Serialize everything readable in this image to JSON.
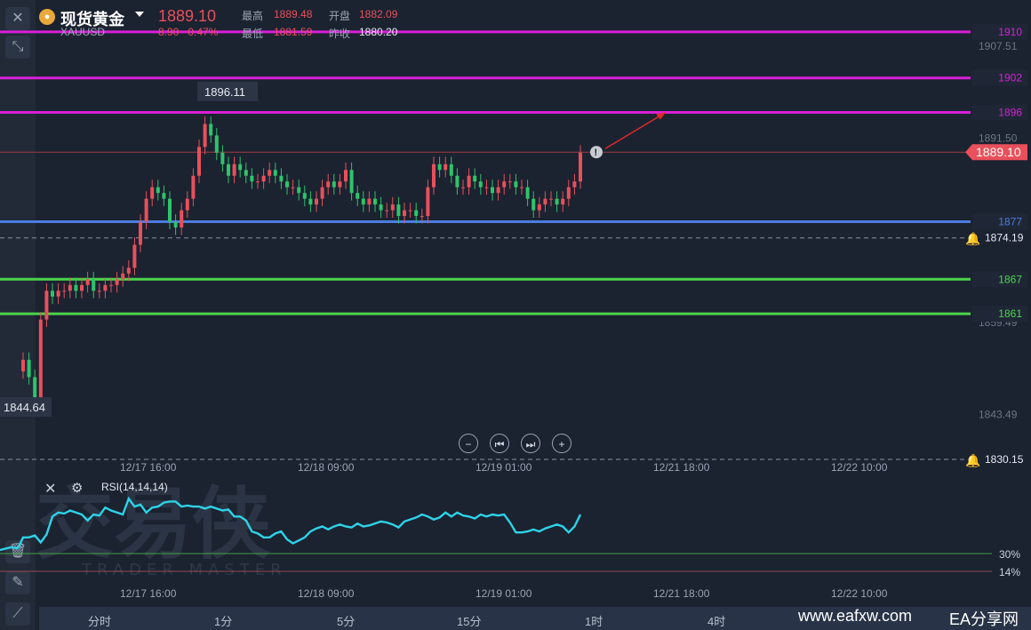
{
  "header": {
    "name": "现货黄金",
    "symbol": "XAUUSD",
    "price": "1889.10",
    "change": "8.90",
    "change_pct": "0.47%",
    "high_label": "最高",
    "high": "1889.48",
    "low_label": "最低",
    "low": "1881.59",
    "open_label": "开盘",
    "open": "1882.09",
    "prev_close_label": "昨收",
    "prev_close": "1880.20"
  },
  "left_toolbar": {
    "icons": [
      "close-icon",
      "collapse-icon",
      "trash-icon",
      "pencil-icon",
      "line-chart-icon"
    ]
  },
  "controls": {
    "icons": [
      "zoom-out-icon",
      "step-back-icon",
      "step-forward-icon",
      "zoom-in-icon"
    ]
  },
  "chart_data": [
    {
      "type": "candlestick",
      "title": "XAUUSD",
      "ylim": [
        1836,
        1914
      ],
      "y_ticks": [
        "1907.51",
        "1891.50",
        "1874.19",
        "1859.49",
        "1843.49"
      ],
      "x_ticks": [
        "12/17 16:00",
        "12/18 09:00",
        "12/19 01:00",
        "12/21 18:00",
        "12/22 10:00"
      ],
      "current_price": "1889.10",
      "high_label": "1896.11",
      "low_label": "1844.64",
      "levels": [
        {
          "label": "1910",
          "value": 1910,
          "color": "#d81fd8"
        },
        {
          "label": "1902",
          "value": 1902,
          "color": "#d81fd8"
        },
        {
          "label": "1896",
          "value": 1896,
          "color": "#d81fd8"
        },
        {
          "label": "1877",
          "value": 1877,
          "color": "#4a7de0"
        },
        {
          "label": "1867",
          "value": 1867,
          "color": "#4cd34c"
        },
        {
          "label": "1861",
          "value": 1861,
          "color": "#4cd34c"
        }
      ],
      "alerts": [
        {
          "label": "1874.19",
          "value": 1874.19
        },
        {
          "label": "1830.15",
          "value": 1830.15
        }
      ],
      "closes": [
        1853,
        1850,
        1846,
        1860,
        1865,
        1864,
        1865,
        1865,
        1866,
        1865,
        1866,
        1867,
        1865,
        1865,
        1866,
        1866,
        1867,
        1868,
        1869,
        1873,
        1877,
        1881,
        1883,
        1882,
        1881,
        1877,
        1876,
        1879,
        1881,
        1885,
        1890,
        1894,
        1892,
        1889,
        1887,
        1885,
        1887,
        1886,
        1885,
        1884,
        1884,
        1885,
        1886,
        1885,
        1884,
        1883,
        1883,
        1882,
        1881,
        1880,
        1881,
        1883,
        1884,
        1883,
        1884,
        1886,
        1882,
        1881,
        1880,
        1881,
        1880,
        1879,
        1879,
        1880,
        1878,
        1879,
        1879,
        1878,
        1878,
        1883,
        1887,
        1886,
        1887,
        1885,
        1883,
        1883,
        1885,
        1884,
        1883,
        1883,
        1882,
        1883,
        1884,
        1884,
        1883,
        1883,
        1881,
        1879,
        1880,
        1881,
        1881,
        1880,
        1881,
        1883,
        1884,
        1889
      ],
      "colors": {
        "up": "#e8505b",
        "down": "#2ec46b"
      }
    },
    {
      "type": "line",
      "title": "RSI(14,14,14)",
      "ylim": [
        0,
        100
      ],
      "levels": [
        {
          "label": "30%",
          "value": 30
        },
        {
          "label": "14%",
          "value": 14
        }
      ],
      "x_ticks": [
        "12/17 16:00",
        "12/18 09:00",
        "12/19 01:00",
        "12/21 18:00",
        "12/22 10:00"
      ],
      "values": [
        35,
        35,
        37,
        30,
        38,
        56,
        60,
        59,
        62,
        60,
        58,
        52,
        58,
        57,
        65,
        62,
        60,
        58,
        74,
        66,
        68,
        60,
        65,
        66,
        70,
        71,
        71,
        66,
        67,
        66,
        66,
        64,
        66,
        64,
        62,
        63,
        56,
        56,
        52,
        41,
        39,
        35,
        35,
        39,
        41,
        33,
        29,
        32,
        35,
        41,
        44,
        46,
        43,
        46,
        48,
        46,
        45,
        49,
        46,
        47,
        49,
        51,
        50,
        48,
        45,
        51,
        53,
        55,
        58,
        56,
        53,
        55,
        60,
        56,
        60,
        57,
        56,
        54,
        58,
        56,
        58,
        57,
        58,
        50,
        40,
        40,
        41,
        43,
        41,
        44,
        46,
        48,
        46,
        40,
        46,
        58
      ],
      "color": "#2ed3e8"
    }
  ],
  "timeframes": [
    "分时",
    "1分",
    "5分",
    "15分",
    "1时",
    "4时"
  ],
  "watermark": {
    "brand": "交易侠",
    "brand_en": "TRADER MASTER",
    "site": "www.eafxw.com",
    "ea": "EA分享网"
  }
}
